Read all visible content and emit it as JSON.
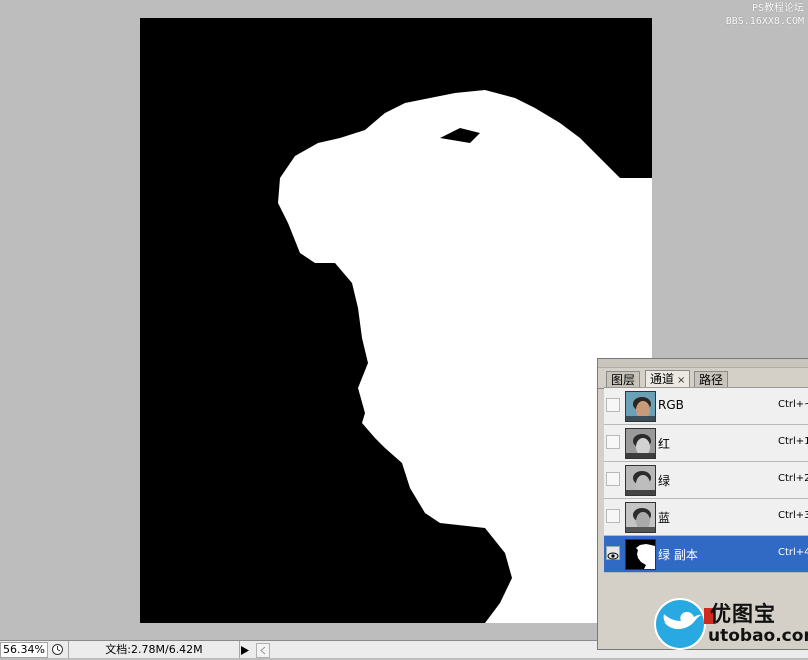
{
  "watermark": {
    "line1": "PS教程论坛",
    "line2": "BBS.16XX8.COM"
  },
  "status_bar": {
    "zoom": "56.34%",
    "doc_info": "文档:2.78M/6.42M"
  },
  "channels_panel": {
    "tabs": [
      {
        "label": "图层",
        "active": false
      },
      {
        "label": "通道",
        "active": true,
        "close": "×"
      },
      {
        "label": "路径",
        "active": false
      }
    ],
    "rows": [
      {
        "name": "RGB",
        "shortcut": "Ctrl+~",
        "visible": false,
        "selected": false,
        "thumb": "color"
      },
      {
        "name": "红",
        "shortcut": "Ctrl+1",
        "visible": false,
        "selected": false,
        "thumb": "gray"
      },
      {
        "name": "绿",
        "shortcut": "Ctrl+2",
        "visible": false,
        "selected": false,
        "thumb": "gray"
      },
      {
        "name": "蓝",
        "shortcut": "Ctrl+3",
        "visible": false,
        "selected": false,
        "thumb": "gray"
      },
      {
        "name": "绿 副本",
        "shortcut": "Ctrl+4",
        "visible": true,
        "selected": true,
        "thumb": "mask"
      }
    ]
  },
  "logo": {
    "name": "优图宝",
    "url": "utobao.com"
  },
  "colors": {
    "selection": "#316ac5",
    "canvas_bg": "#000000",
    "workspace": "#bdbdbd"
  }
}
